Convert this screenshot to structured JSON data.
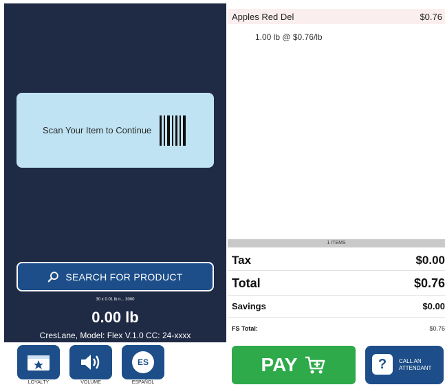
{
  "left": {
    "scan_prompt": "Scan Your Item to Continue",
    "search_label": "SEARCH FOR PRODUCT",
    "scale_capacity": "30 x 0.01 lb n... 3000",
    "weight": "0.00 lb",
    "model_info": "CresLane, Model: Flex V.1.0 CC: 24-xxxx"
  },
  "bottom_buttons": {
    "loyalty": "LOYALTY",
    "volume": "VOLUME",
    "espanol": "ESPAÑOL",
    "espanol_icon_text": "ES"
  },
  "receipt": {
    "items": [
      {
        "name": "Apples Red Del",
        "price": "$0.76",
        "detail": "1.00 lb @ $0.76/lb"
      }
    ],
    "items_count": "1 ITEMS",
    "tax_label": "Tax",
    "tax_value": "$0.00",
    "total_label": "Total",
    "total_value": "$0.76",
    "savings_label": "Savings",
    "savings_value": "$0.00",
    "fs_total_label": "FS Total:",
    "fs_total_value": "$0.76"
  },
  "actions": {
    "pay_label": "PAY",
    "attendant_label_line1": "CALL AN",
    "attendant_label_line2": "ATTENDANT",
    "attendant_icon_text": "?"
  },
  "colors": {
    "panel_bg": "#1f2a44",
    "scan_card": "#bfe3f2",
    "brand_blue": "#1d4e89",
    "pay_green": "#2eaa4a",
    "item_highlight": "#fbeeee"
  }
}
